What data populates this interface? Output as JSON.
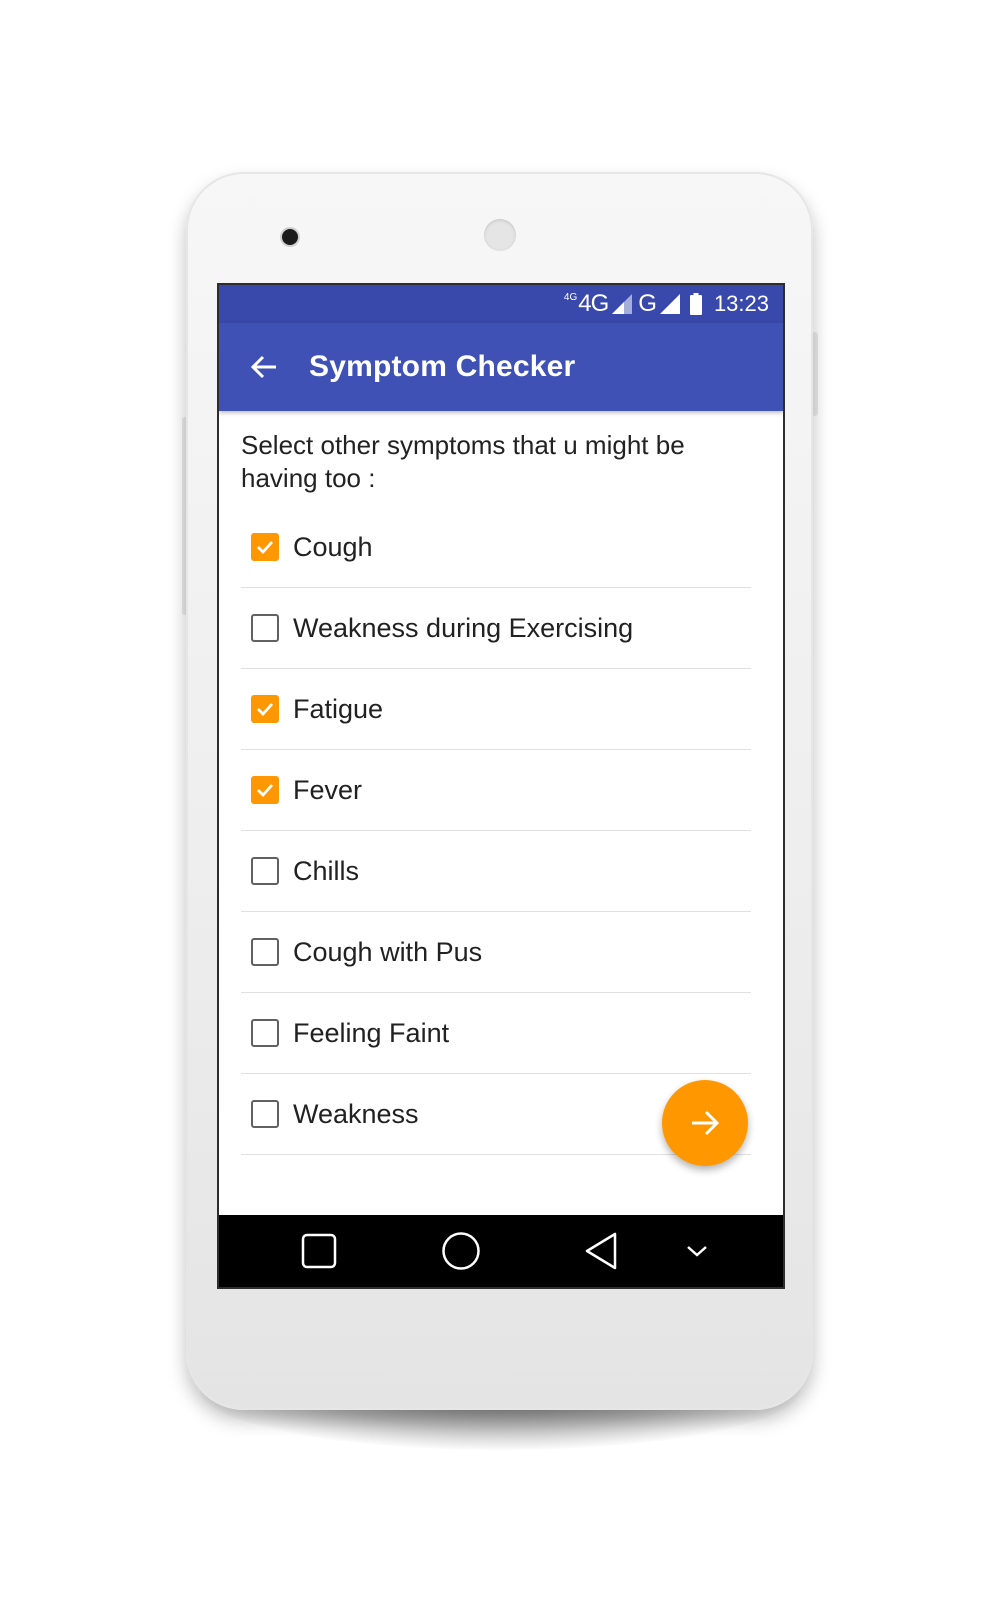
{
  "status_bar": {
    "network_small": "4G",
    "network_primary": "4G",
    "network_secondary": "G",
    "time": "13:23"
  },
  "app_bar": {
    "title": "Symptom Checker",
    "back_icon": "arrow-left-icon"
  },
  "prompt": "Select other symptoms that u might be having too :",
  "symptoms": [
    {
      "label": "Cough",
      "checked": true
    },
    {
      "label": "Weakness during Exercising",
      "checked": false
    },
    {
      "label": "Fatigue",
      "checked": true
    },
    {
      "label": "Fever",
      "checked": true
    },
    {
      "label": "Chills",
      "checked": false
    },
    {
      "label": "Cough with Pus",
      "checked": false
    },
    {
      "label": "Feeling Faint",
      "checked": false
    },
    {
      "label": "Weakness",
      "checked": false
    }
  ],
  "fab": {
    "icon": "arrow-right-icon"
  },
  "nav_bar": {
    "icons": [
      "recents-square-icon",
      "home-circle-icon",
      "back-triangle-icon",
      "chevron-down-icon"
    ]
  },
  "colors": {
    "primary": "#3f51b5",
    "primary_dark": "#3949ab",
    "accent": "#ff9800"
  }
}
